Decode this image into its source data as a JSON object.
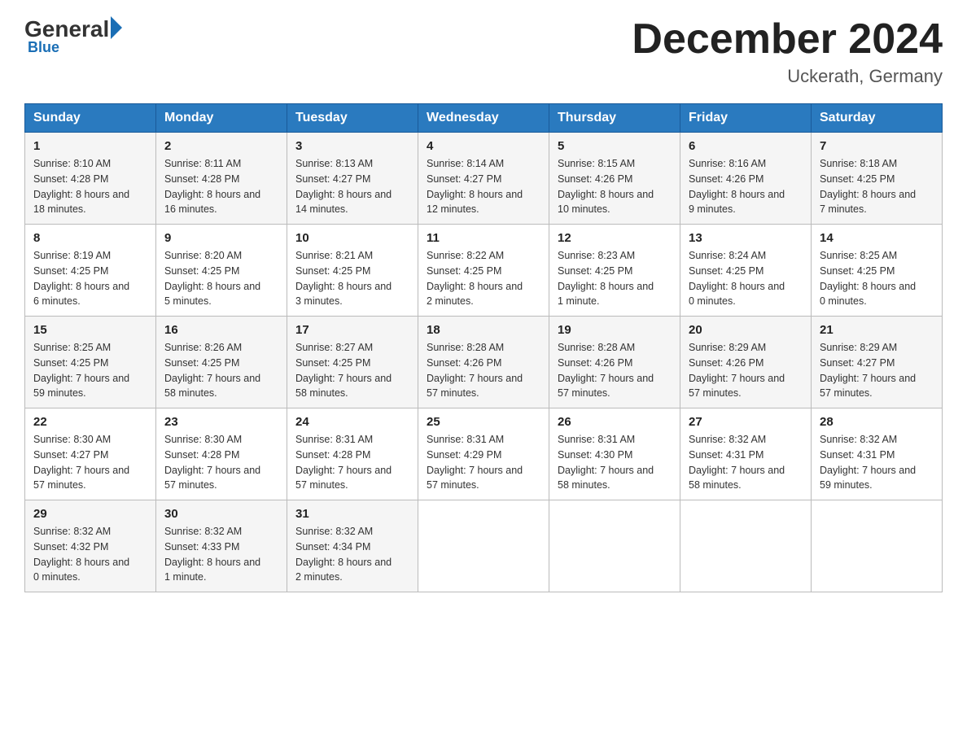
{
  "logo": {
    "general": "General",
    "blue": "Blue",
    "subtitle": "Blue"
  },
  "header": {
    "title": "December 2024",
    "location": "Uckerath, Germany"
  },
  "weekdays": [
    "Sunday",
    "Monday",
    "Tuesday",
    "Wednesday",
    "Thursday",
    "Friday",
    "Saturday"
  ],
  "weeks": [
    [
      {
        "day": "1",
        "sunrise": "8:10 AM",
        "sunset": "4:28 PM",
        "daylight": "8 hours and 18 minutes."
      },
      {
        "day": "2",
        "sunrise": "8:11 AM",
        "sunset": "4:28 PM",
        "daylight": "8 hours and 16 minutes."
      },
      {
        "day": "3",
        "sunrise": "8:13 AM",
        "sunset": "4:27 PM",
        "daylight": "8 hours and 14 minutes."
      },
      {
        "day": "4",
        "sunrise": "8:14 AM",
        "sunset": "4:27 PM",
        "daylight": "8 hours and 12 minutes."
      },
      {
        "day": "5",
        "sunrise": "8:15 AM",
        "sunset": "4:26 PM",
        "daylight": "8 hours and 10 minutes."
      },
      {
        "day": "6",
        "sunrise": "8:16 AM",
        "sunset": "4:26 PM",
        "daylight": "8 hours and 9 minutes."
      },
      {
        "day": "7",
        "sunrise": "8:18 AM",
        "sunset": "4:25 PM",
        "daylight": "8 hours and 7 minutes."
      }
    ],
    [
      {
        "day": "8",
        "sunrise": "8:19 AM",
        "sunset": "4:25 PM",
        "daylight": "8 hours and 6 minutes."
      },
      {
        "day": "9",
        "sunrise": "8:20 AM",
        "sunset": "4:25 PM",
        "daylight": "8 hours and 5 minutes."
      },
      {
        "day": "10",
        "sunrise": "8:21 AM",
        "sunset": "4:25 PM",
        "daylight": "8 hours and 3 minutes."
      },
      {
        "day": "11",
        "sunrise": "8:22 AM",
        "sunset": "4:25 PM",
        "daylight": "8 hours and 2 minutes."
      },
      {
        "day": "12",
        "sunrise": "8:23 AM",
        "sunset": "4:25 PM",
        "daylight": "8 hours and 1 minute."
      },
      {
        "day": "13",
        "sunrise": "8:24 AM",
        "sunset": "4:25 PM",
        "daylight": "8 hours and 0 minutes."
      },
      {
        "day": "14",
        "sunrise": "8:25 AM",
        "sunset": "4:25 PM",
        "daylight": "8 hours and 0 minutes."
      }
    ],
    [
      {
        "day": "15",
        "sunrise": "8:25 AM",
        "sunset": "4:25 PM",
        "daylight": "7 hours and 59 minutes."
      },
      {
        "day": "16",
        "sunrise": "8:26 AM",
        "sunset": "4:25 PM",
        "daylight": "7 hours and 58 minutes."
      },
      {
        "day": "17",
        "sunrise": "8:27 AM",
        "sunset": "4:25 PM",
        "daylight": "7 hours and 58 minutes."
      },
      {
        "day": "18",
        "sunrise": "8:28 AM",
        "sunset": "4:26 PM",
        "daylight": "7 hours and 57 minutes."
      },
      {
        "day": "19",
        "sunrise": "8:28 AM",
        "sunset": "4:26 PM",
        "daylight": "7 hours and 57 minutes."
      },
      {
        "day": "20",
        "sunrise": "8:29 AM",
        "sunset": "4:26 PM",
        "daylight": "7 hours and 57 minutes."
      },
      {
        "day": "21",
        "sunrise": "8:29 AM",
        "sunset": "4:27 PM",
        "daylight": "7 hours and 57 minutes."
      }
    ],
    [
      {
        "day": "22",
        "sunrise": "8:30 AM",
        "sunset": "4:27 PM",
        "daylight": "7 hours and 57 minutes."
      },
      {
        "day": "23",
        "sunrise": "8:30 AM",
        "sunset": "4:28 PM",
        "daylight": "7 hours and 57 minutes."
      },
      {
        "day": "24",
        "sunrise": "8:31 AM",
        "sunset": "4:28 PM",
        "daylight": "7 hours and 57 minutes."
      },
      {
        "day": "25",
        "sunrise": "8:31 AM",
        "sunset": "4:29 PM",
        "daylight": "7 hours and 57 minutes."
      },
      {
        "day": "26",
        "sunrise": "8:31 AM",
        "sunset": "4:30 PM",
        "daylight": "7 hours and 58 minutes."
      },
      {
        "day": "27",
        "sunrise": "8:32 AM",
        "sunset": "4:31 PM",
        "daylight": "7 hours and 58 minutes."
      },
      {
        "day": "28",
        "sunrise": "8:32 AM",
        "sunset": "4:31 PM",
        "daylight": "7 hours and 59 minutes."
      }
    ],
    [
      {
        "day": "29",
        "sunrise": "8:32 AM",
        "sunset": "4:32 PM",
        "daylight": "8 hours and 0 minutes."
      },
      {
        "day": "30",
        "sunrise": "8:32 AM",
        "sunset": "4:33 PM",
        "daylight": "8 hours and 1 minute."
      },
      {
        "day": "31",
        "sunrise": "8:32 AM",
        "sunset": "4:34 PM",
        "daylight": "8 hours and 2 minutes."
      },
      null,
      null,
      null,
      null
    ]
  ],
  "labels": {
    "sunrise": "Sunrise:",
    "sunset": "Sunset:",
    "daylight": "Daylight:"
  }
}
